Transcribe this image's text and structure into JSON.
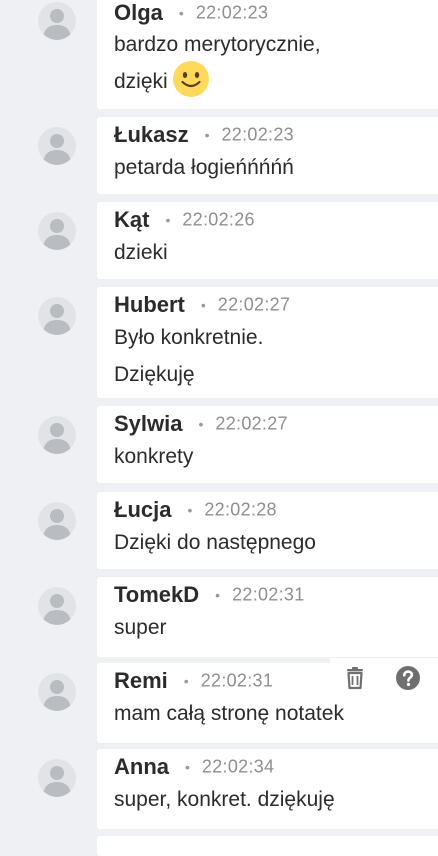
{
  "messages": [
    {
      "author": "Olga",
      "time": "22:02:23",
      "lines": [
        "bardzo merytorycznie,",
        "dzięki"
      ],
      "emoji": "smiling-face"
    },
    {
      "author": "Łukasz",
      "time": "22:02:23",
      "lines": [
        "petarda łogieńńńńń"
      ]
    },
    {
      "author": "Kąt",
      "time": "22:02:26",
      "lines": [
        "dzieki"
      ]
    },
    {
      "author": "Hubert",
      "time": "22:02:27",
      "lines": [
        "Było konkretnie.",
        "Dziękuję"
      ]
    },
    {
      "author": "Sylwia",
      "time": "22:02:27",
      "lines": [
        "konkrety"
      ]
    },
    {
      "author": "Łucja",
      "time": "22:02:28",
      "lines": [
        "Dzięki do następnego"
      ]
    },
    {
      "author": "TomekD",
      "time": "22:02:31",
      "lines": [
        "super"
      ]
    },
    {
      "author": "Remi",
      "time": "22:02:31",
      "lines": [
        "mam całą stronę notatek"
      ]
    },
    {
      "author": "Anna",
      "time": "22:02:34",
      "lines": [
        "super, konkret. dziękuję"
      ]
    }
  ],
  "separator": "•",
  "hover_actions": [
    {
      "name": "trash-icon",
      "color": "#6f6f6f"
    },
    {
      "name": "help-circle-icon",
      "color": "#6f6f6f"
    }
  ],
  "colors": {
    "background": "#eef0f4",
    "card": "#ffffff",
    "author": "#2b2b2b",
    "timestamp": "#8f8f8f",
    "avatar": "#e1e3e6",
    "emoji": "#ffd95a"
  }
}
